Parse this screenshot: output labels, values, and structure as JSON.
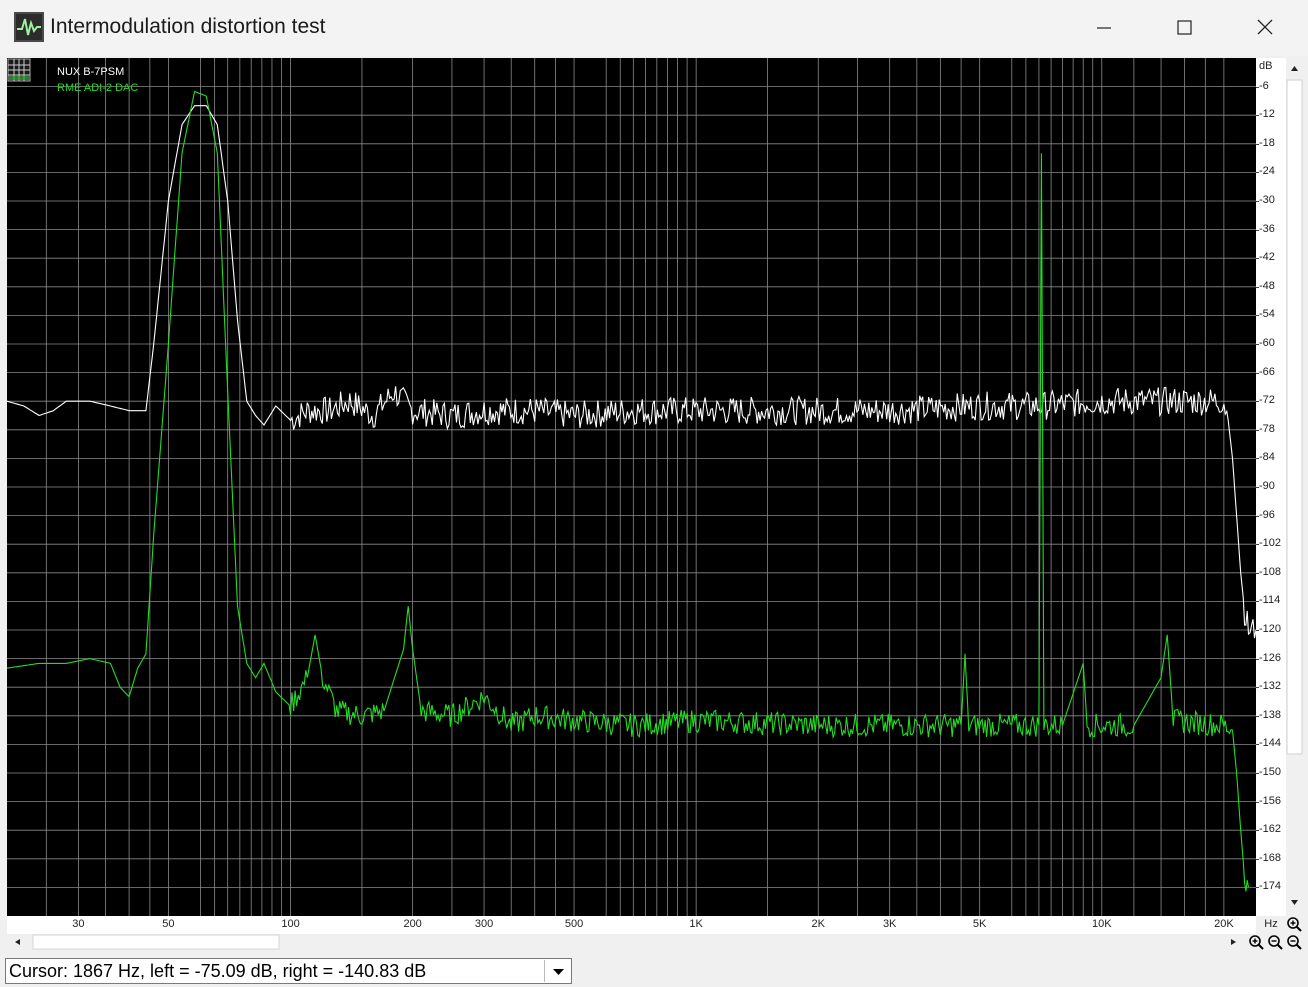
{
  "window": {
    "title": "Intermodulation distortion test",
    "app_icon": "spectrum-app-icon",
    "controls": [
      "minimize-icon",
      "maximize-icon",
      "close-icon"
    ]
  },
  "legend": [
    {
      "name": "NUX B-7PSM",
      "color": "#ffffff"
    },
    {
      "name": "RME ADI-2 DAC",
      "color": "#22dd22"
    }
  ],
  "axis": {
    "y_unit": "dB",
    "x_unit": "Hz",
    "y_ticks": [
      "-6",
      "-12",
      "-18",
      "-24",
      "-30",
      "-36",
      "-42",
      "-48",
      "-54",
      "-60",
      "-66",
      "-72",
      "-78",
      "-84",
      "-90",
      "-96",
      "-102",
      "-108",
      "-114",
      "-120",
      "-126",
      "-132",
      "-138",
      "-144",
      "-150",
      "-156",
      "-162",
      "-168",
      "-174"
    ],
    "x_ticks": [
      "30",
      "50",
      "100",
      "200",
      "300",
      "500",
      "1K",
      "2K",
      "3K",
      "5K",
      "10K",
      "20K"
    ]
  },
  "chart_data": {
    "type": "line",
    "xlabel": "Hz",
    "ylabel": "dB",
    "x_scale": "log",
    "xlim": [
      20,
      24000
    ],
    "ylim": [
      -180,
      0
    ],
    "grid": true,
    "legend_position": "top-left",
    "series": [
      {
        "name": "NUX B-7PSM",
        "color": "#ffffff",
        "points": [
          [
            20,
            -72
          ],
          [
            22,
            -73
          ],
          [
            24,
            -75
          ],
          [
            26,
            -74
          ],
          [
            28,
            -72
          ],
          [
            32,
            -72
          ],
          [
            36,
            -73
          ],
          [
            40,
            -74
          ],
          [
            44,
            -74
          ],
          [
            46,
            -60
          ],
          [
            50,
            -30
          ],
          [
            54,
            -14
          ],
          [
            58,
            -10
          ],
          [
            62,
            -10
          ],
          [
            66,
            -14
          ],
          [
            70,
            -30
          ],
          [
            74,
            -55
          ],
          [
            78,
            -72
          ],
          [
            82,
            -75
          ],
          [
            86,
            -77
          ],
          [
            92,
            -73
          ],
          [
            100,
            -76
          ],
          [
            110,
            -74
          ],
          [
            125,
            -74
          ],
          [
            140,
            -72
          ],
          [
            160,
            -75
          ],
          [
            180,
            -70
          ],
          [
            200,
            -74
          ],
          [
            250,
            -75
          ],
          [
            300,
            -74
          ],
          [
            400,
            -74
          ],
          [
            500,
            -75
          ],
          [
            700,
            -74
          ],
          [
            1000,
            -74
          ],
          [
            1500,
            -74
          ],
          [
            2000,
            -74
          ],
          [
            3000,
            -74
          ],
          [
            5000,
            -73
          ],
          [
            7000,
            -73
          ],
          [
            10000,
            -72
          ],
          [
            15000,
            -72
          ],
          [
            20000,
            -72
          ],
          [
            20500,
            -76
          ],
          [
            21000,
            -84
          ],
          [
            21500,
            -96
          ],
          [
            22000,
            -108
          ],
          [
            22500,
            -116
          ],
          [
            23000,
            -120
          ],
          [
            24000,
            -120
          ]
        ]
      },
      {
        "name": "RME ADI-2 DAC",
        "color": "#22dd22",
        "points": [
          [
            20,
            -128
          ],
          [
            24,
            -127
          ],
          [
            28,
            -127
          ],
          [
            32,
            -126
          ],
          [
            36,
            -127
          ],
          [
            38,
            -132
          ],
          [
            40,
            -134
          ],
          [
            42,
            -128
          ],
          [
            44,
            -125
          ],
          [
            46,
            -100
          ],
          [
            50,
            -60
          ],
          [
            54,
            -20
          ],
          [
            58,
            -7
          ],
          [
            62,
            -8
          ],
          [
            66,
            -20
          ],
          [
            70,
            -70
          ],
          [
            74,
            -115
          ],
          [
            78,
            -127
          ],
          [
            82,
            -130
          ],
          [
            86,
            -127
          ],
          [
            92,
            -133
          ],
          [
            100,
            -136
          ],
          [
            110,
            -130
          ],
          [
            115,
            -121
          ],
          [
            120,
            -130
          ],
          [
            130,
            -137
          ],
          [
            150,
            -138
          ],
          [
            170,
            -137
          ],
          [
            190,
            -124
          ],
          [
            195,
            -115
          ],
          [
            200,
            -124
          ],
          [
            210,
            -137
          ],
          [
            250,
            -138
          ],
          [
            300,
            -134
          ],
          [
            350,
            -140
          ],
          [
            400,
            -138
          ],
          [
            500,
            -139
          ],
          [
            700,
            -140
          ],
          [
            1000,
            -139
          ],
          [
            2000,
            -140
          ],
          [
            3000,
            -140
          ],
          [
            4500,
            -140
          ],
          [
            4600,
            -125
          ],
          [
            4700,
            -140
          ],
          [
            6000,
            -140
          ],
          [
            7000,
            -140
          ],
          [
            7100,
            -20
          ],
          [
            7200,
            -140
          ],
          [
            8000,
            -140
          ],
          [
            9000,
            -127
          ],
          [
            9200,
            -140
          ],
          [
            12000,
            -140
          ],
          [
            14000,
            -130
          ],
          [
            14500,
            -121
          ],
          [
            15000,
            -139
          ],
          [
            20000,
            -140
          ],
          [
            21000,
            -141
          ],
          [
            21500,
            -150
          ],
          [
            22000,
            -162
          ],
          [
            22500,
            -172
          ],
          [
            23000,
            -174
          ]
        ]
      }
    ]
  },
  "status": {
    "cursor_text": "Cursor:  1867 Hz,  left = -75.09 dB,  right = -140.83 dB"
  }
}
